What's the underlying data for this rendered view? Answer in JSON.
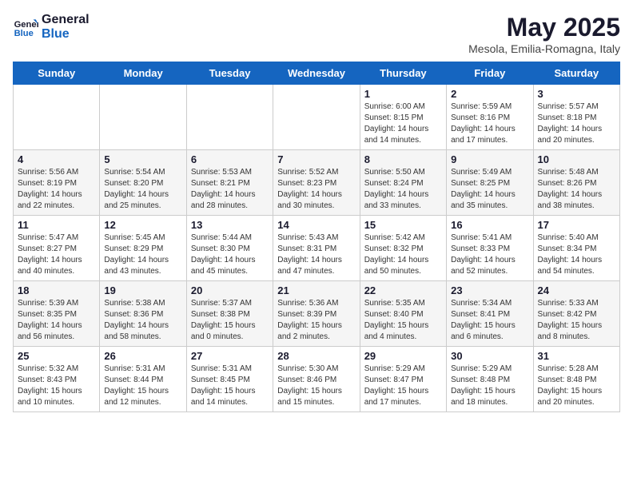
{
  "header": {
    "logo_line1": "General",
    "logo_line2": "Blue",
    "title": "May 2025",
    "subtitle": "Mesola, Emilia-Romagna, Italy"
  },
  "weekdays": [
    "Sunday",
    "Monday",
    "Tuesday",
    "Wednesday",
    "Thursday",
    "Friday",
    "Saturday"
  ],
  "weeks": [
    [
      {
        "day": "",
        "info": ""
      },
      {
        "day": "",
        "info": ""
      },
      {
        "day": "",
        "info": ""
      },
      {
        "day": "",
        "info": ""
      },
      {
        "day": "1",
        "info": "Sunrise: 6:00 AM\nSunset: 8:15 PM\nDaylight: 14 hours\nand 14 minutes."
      },
      {
        "day": "2",
        "info": "Sunrise: 5:59 AM\nSunset: 8:16 PM\nDaylight: 14 hours\nand 17 minutes."
      },
      {
        "day": "3",
        "info": "Sunrise: 5:57 AM\nSunset: 8:18 PM\nDaylight: 14 hours\nand 20 minutes."
      }
    ],
    [
      {
        "day": "4",
        "info": "Sunrise: 5:56 AM\nSunset: 8:19 PM\nDaylight: 14 hours\nand 22 minutes."
      },
      {
        "day": "5",
        "info": "Sunrise: 5:54 AM\nSunset: 8:20 PM\nDaylight: 14 hours\nand 25 minutes."
      },
      {
        "day": "6",
        "info": "Sunrise: 5:53 AM\nSunset: 8:21 PM\nDaylight: 14 hours\nand 28 minutes."
      },
      {
        "day": "7",
        "info": "Sunrise: 5:52 AM\nSunset: 8:23 PM\nDaylight: 14 hours\nand 30 minutes."
      },
      {
        "day": "8",
        "info": "Sunrise: 5:50 AM\nSunset: 8:24 PM\nDaylight: 14 hours\nand 33 minutes."
      },
      {
        "day": "9",
        "info": "Sunrise: 5:49 AM\nSunset: 8:25 PM\nDaylight: 14 hours\nand 35 minutes."
      },
      {
        "day": "10",
        "info": "Sunrise: 5:48 AM\nSunset: 8:26 PM\nDaylight: 14 hours\nand 38 minutes."
      }
    ],
    [
      {
        "day": "11",
        "info": "Sunrise: 5:47 AM\nSunset: 8:27 PM\nDaylight: 14 hours\nand 40 minutes."
      },
      {
        "day": "12",
        "info": "Sunrise: 5:45 AM\nSunset: 8:29 PM\nDaylight: 14 hours\nand 43 minutes."
      },
      {
        "day": "13",
        "info": "Sunrise: 5:44 AM\nSunset: 8:30 PM\nDaylight: 14 hours\nand 45 minutes."
      },
      {
        "day": "14",
        "info": "Sunrise: 5:43 AM\nSunset: 8:31 PM\nDaylight: 14 hours\nand 47 minutes."
      },
      {
        "day": "15",
        "info": "Sunrise: 5:42 AM\nSunset: 8:32 PM\nDaylight: 14 hours\nand 50 minutes."
      },
      {
        "day": "16",
        "info": "Sunrise: 5:41 AM\nSunset: 8:33 PM\nDaylight: 14 hours\nand 52 minutes."
      },
      {
        "day": "17",
        "info": "Sunrise: 5:40 AM\nSunset: 8:34 PM\nDaylight: 14 hours\nand 54 minutes."
      }
    ],
    [
      {
        "day": "18",
        "info": "Sunrise: 5:39 AM\nSunset: 8:35 PM\nDaylight: 14 hours\nand 56 minutes."
      },
      {
        "day": "19",
        "info": "Sunrise: 5:38 AM\nSunset: 8:36 PM\nDaylight: 14 hours\nand 58 minutes."
      },
      {
        "day": "20",
        "info": "Sunrise: 5:37 AM\nSunset: 8:38 PM\nDaylight: 15 hours\nand 0 minutes."
      },
      {
        "day": "21",
        "info": "Sunrise: 5:36 AM\nSunset: 8:39 PM\nDaylight: 15 hours\nand 2 minutes."
      },
      {
        "day": "22",
        "info": "Sunrise: 5:35 AM\nSunset: 8:40 PM\nDaylight: 15 hours\nand 4 minutes."
      },
      {
        "day": "23",
        "info": "Sunrise: 5:34 AM\nSunset: 8:41 PM\nDaylight: 15 hours\nand 6 minutes."
      },
      {
        "day": "24",
        "info": "Sunrise: 5:33 AM\nSunset: 8:42 PM\nDaylight: 15 hours\nand 8 minutes."
      }
    ],
    [
      {
        "day": "25",
        "info": "Sunrise: 5:32 AM\nSunset: 8:43 PM\nDaylight: 15 hours\nand 10 minutes."
      },
      {
        "day": "26",
        "info": "Sunrise: 5:31 AM\nSunset: 8:44 PM\nDaylight: 15 hours\nand 12 minutes."
      },
      {
        "day": "27",
        "info": "Sunrise: 5:31 AM\nSunset: 8:45 PM\nDaylight: 15 hours\nand 14 minutes."
      },
      {
        "day": "28",
        "info": "Sunrise: 5:30 AM\nSunset: 8:46 PM\nDaylight: 15 hours\nand 15 minutes."
      },
      {
        "day": "29",
        "info": "Sunrise: 5:29 AM\nSunset: 8:47 PM\nDaylight: 15 hours\nand 17 minutes."
      },
      {
        "day": "30",
        "info": "Sunrise: 5:29 AM\nSunset: 8:48 PM\nDaylight: 15 hours\nand 18 minutes."
      },
      {
        "day": "31",
        "info": "Sunrise: 5:28 AM\nSunset: 8:48 PM\nDaylight: 15 hours\nand 20 minutes."
      }
    ]
  ]
}
